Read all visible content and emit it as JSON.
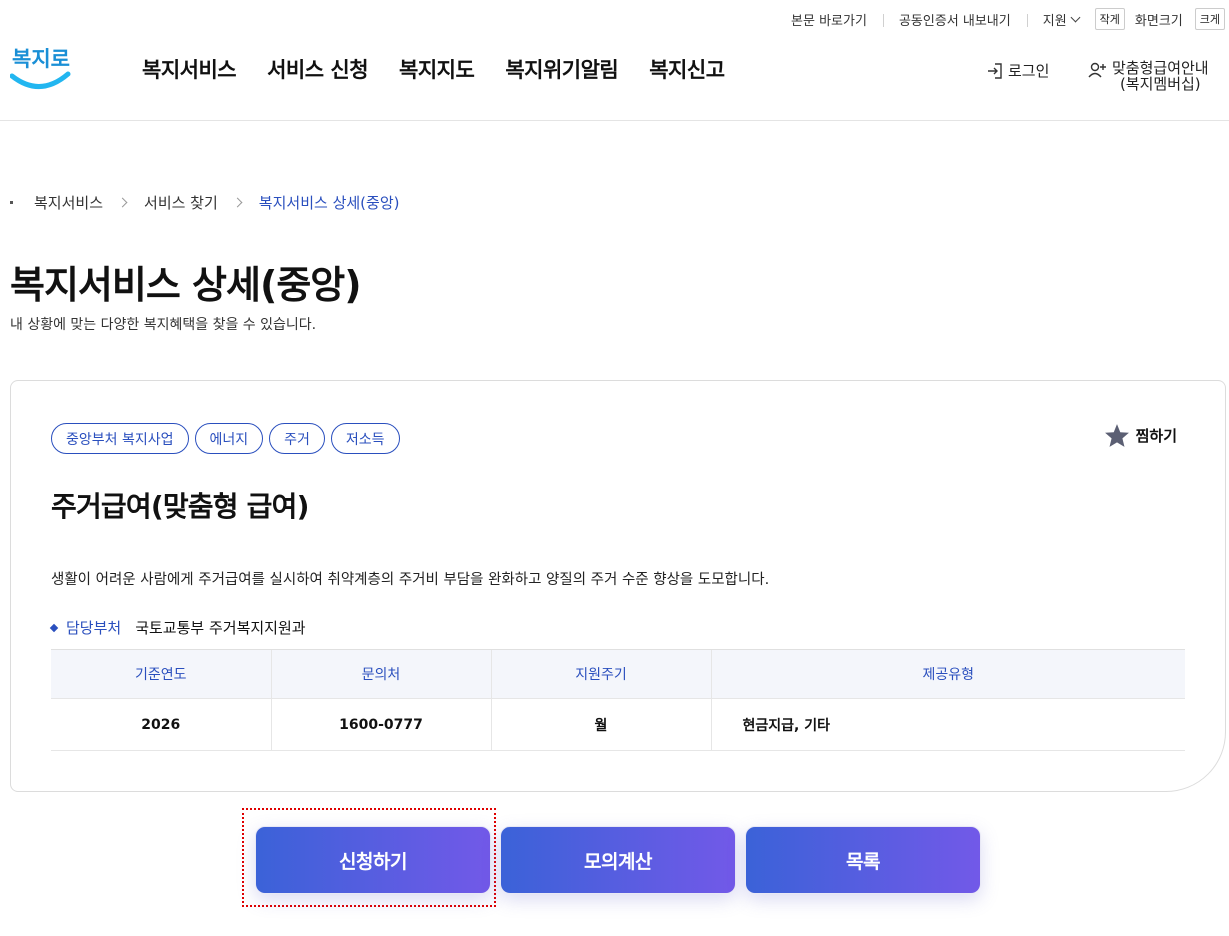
{
  "utility": {
    "skip_link": "본문 바로가기",
    "cert_export": "공동인증서 내보내기",
    "lang": "지원",
    "font_small": "작게",
    "font_size_label": "화면크기",
    "font_large": "크게"
  },
  "header": {
    "logo_text": "복지로",
    "nav": [
      "복지서비스",
      "서비스 신청",
      "복지지도",
      "복지위기알림",
      "복지신고"
    ],
    "login": "로그인",
    "custom_line1": "맞춤형급여안내",
    "custom_line2": "(복지멤버십)"
  },
  "breadcrumb": [
    "복지서비스",
    "서비스 찾기",
    "복지서비스 상세(중앙)"
  ],
  "page": {
    "title": "복지서비스 상세(중앙)",
    "description": "내 상황에 맞는 다양한 복지혜택을 찾을 수 있습니다."
  },
  "service": {
    "tags": [
      "중앙부처 복지사업",
      "에너지",
      "주거",
      "저소득"
    ],
    "favorite": "찜하기",
    "title": "주거급여(맞춤형 급여)",
    "description": "생활이 어려운 사람에게 주거급여를 실시하여 취약계층의 주거비 부담을 완화하고 양질의 주거 수준 향상을 도모합니다.",
    "dept_label": "담당부처",
    "dept_value": "국토교통부 주거복지지원과",
    "table": {
      "headers": [
        "기준연도",
        "문의처",
        "지원주기",
        "제공유형"
      ],
      "row": [
        "2026",
        "1600-0777",
        "월",
        "현금지급, 기타"
      ]
    }
  },
  "actions": {
    "apply": "신청하기",
    "simulate": "모의계산",
    "list": "목록"
  },
  "colors": {
    "accent": "#2a4fbe",
    "button_start": "#3b62d8",
    "button_end": "#7259e8",
    "focus": "#e00000"
  }
}
